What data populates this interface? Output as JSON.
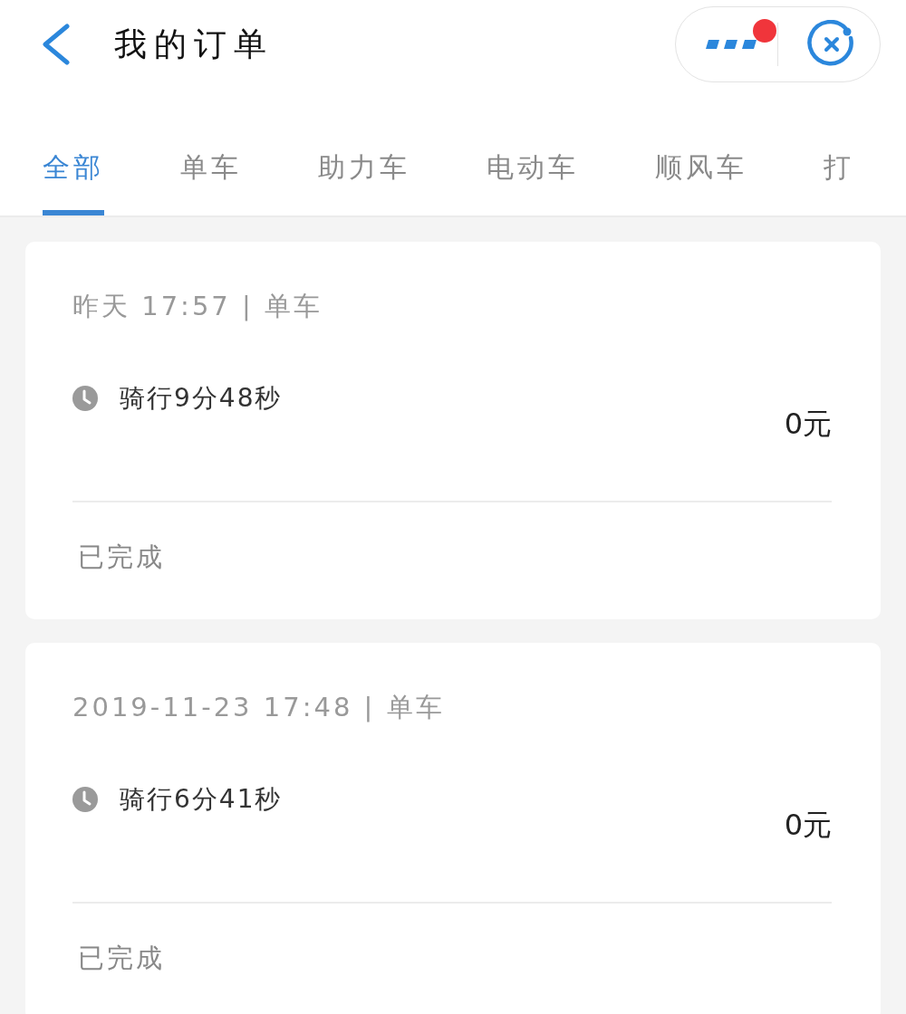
{
  "header": {
    "title": "我的订单",
    "capsule": {
      "badge": true
    }
  },
  "tabs": [
    {
      "label": "全部",
      "selected": true
    },
    {
      "label": "单车",
      "selected": false
    },
    {
      "label": "助力车",
      "selected": false
    },
    {
      "label": "电动车",
      "selected": false
    },
    {
      "label": "顺风车",
      "selected": false
    },
    {
      "label": "打",
      "selected": false
    }
  ],
  "orders": [
    {
      "meta": "昨天 17:57 | 单车",
      "duration": "骑行9分48秒",
      "amount": "0元",
      "status": "已完成"
    },
    {
      "meta": "2019-11-23 17:48 | 单车",
      "duration": "骑行6分41秒",
      "amount": "0元",
      "status": "已完成"
    }
  ]
}
